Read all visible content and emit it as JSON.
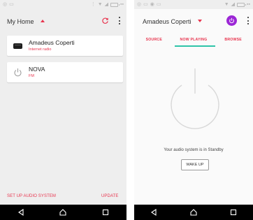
{
  "left_screen": {
    "home_title": "My Home",
    "devices": [
      {
        "name": "Amadeus Coperti",
        "source": "Internet radio",
        "icon": "speaker-icon"
      },
      {
        "name": "NOVA",
        "source": "FM",
        "icon": "power-icon"
      }
    ],
    "setup_label": "SET UP AUDIO SYSTEM",
    "update_label": "UPDATE"
  },
  "right_screen": {
    "device_title": "Amadeus Coperti",
    "tabs": [
      {
        "label": "SOURCE",
        "active": false
      },
      {
        "label": "NOW PLAYING",
        "active": true
      },
      {
        "label": "BROWSE",
        "active": false
      }
    ],
    "standby_message": "Your audio system is in Standby",
    "wake_label": "WAKE UP"
  },
  "colors": {
    "accent": "#e8344e",
    "tab_indicator": "#2ec4a8",
    "power_button": "#9c27d6"
  }
}
